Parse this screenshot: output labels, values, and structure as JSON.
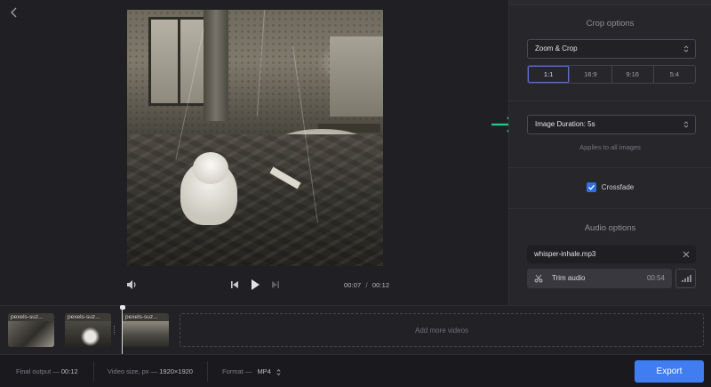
{
  "player": {
    "current_time": "00:07",
    "time_separator": "/",
    "total_time": "00:12"
  },
  "crop": {
    "title": "Crop options",
    "mode": "Zoom & Crop",
    "ratios": [
      "1:1",
      "16:9",
      "9:16",
      "5:4"
    ],
    "active_ratio": "1:1"
  },
  "duration": {
    "value": "Image Duration: 5s",
    "hint": "Applies to all images"
  },
  "crossfade": {
    "label": "Crossfade",
    "checked": true
  },
  "audio": {
    "title": "Audio options",
    "file": "whisper-inhale.mp3",
    "trim_label": "Trim audio",
    "trim_duration": "00:54"
  },
  "timeline": {
    "clips": [
      {
        "label": "pexels-suz..."
      },
      {
        "label": "pexels-suz..."
      },
      {
        "label": "pexels-suz..."
      }
    ],
    "add_more": "Add more videos"
  },
  "footer": {
    "final_output_label": "Final output —",
    "final_output_value": "00:12",
    "video_size_label": "Video size, px —",
    "video_size_value": "1920×1920",
    "format_label": "Format —",
    "format_value": "MP4",
    "export_label": "Export"
  },
  "colors": {
    "accent": "#3f7df0",
    "annotation_arrow": "#27c98a",
    "background": "#1c1c20"
  }
}
